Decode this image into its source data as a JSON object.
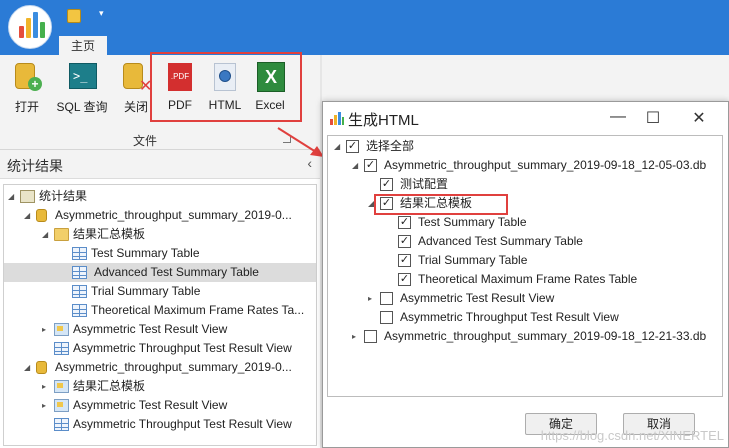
{
  "titlebar": {
    "tab_home": "主页",
    "qa_dropdown": "▾"
  },
  "ribbon": {
    "buttons": [
      {
        "id": "open",
        "label": "打开"
      },
      {
        "id": "sql",
        "label": "SQL 查询"
      },
      {
        "id": "close",
        "label": "关闭"
      },
      {
        "id": "pdf",
        "label": "PDF",
        "icon_text": ".PDF"
      },
      {
        "id": "html",
        "label": "HTML"
      },
      {
        "id": "excel",
        "label": "Excel",
        "icon_text": "X"
      }
    ],
    "group_label": "文件"
  },
  "left_panel": {
    "title": "统计结果",
    "collapse_glyph": "‹",
    "tree": [
      {
        "text": "统计结果",
        "icon": "root-icon",
        "level": 0,
        "toggle": "◢"
      },
      {
        "text": "Asymmetric_throughput_summary_2019-0...",
        "icon": "database-icon",
        "level": 1,
        "toggle": "◢"
      },
      {
        "text": "结果汇总模板",
        "icon": "folder-icon",
        "level": 2,
        "toggle": "◢"
      },
      {
        "text": "Test Summary Table",
        "icon": "table-icon",
        "level": 3,
        "toggle": ""
      },
      {
        "text": "Advanced Test Summary Table",
        "icon": "table-icon",
        "level": 3,
        "toggle": "",
        "selected": true
      },
      {
        "text": "Trial Summary Table",
        "icon": "table-icon",
        "level": 3,
        "toggle": ""
      },
      {
        "text": "Theoretical Maximum Frame Rates Ta...",
        "icon": "table-icon",
        "level": 3,
        "toggle": ""
      },
      {
        "text": "Asymmetric Test Result View",
        "icon": "view-icon",
        "level": 2,
        "toggle": "▸"
      },
      {
        "text": "Asymmetric Throughput Test Result View",
        "icon": "table-icon",
        "level": 2,
        "toggle": ""
      },
      {
        "text": "Asymmetric_throughput_summary_2019-0...",
        "icon": "database-icon",
        "level": 1,
        "toggle": "◢"
      },
      {
        "text": "结果汇总模板",
        "icon": "view-icon",
        "level": 2,
        "toggle": "▸"
      },
      {
        "text": "Asymmetric Test Result View",
        "icon": "view-icon",
        "level": 2,
        "toggle": "▸"
      },
      {
        "text": "Asymmetric Throughput Test Result View",
        "icon": "table-icon",
        "level": 2,
        "toggle": ""
      }
    ]
  },
  "dialog": {
    "title": "生成HTML",
    "minimize_glyph": "—",
    "maximize_glyph": "☐",
    "close_glyph": "✕",
    "tree": [
      {
        "text": "选择全部",
        "checked": true,
        "level": 0,
        "toggle": "◢"
      },
      {
        "text": "Asymmetric_throughput_summary_2019-09-18_12-05-03.db",
        "checked": true,
        "level": 1,
        "toggle": "◢"
      },
      {
        "text": "测试配置",
        "checked": true,
        "level": 2,
        "toggle": ""
      },
      {
        "text": "结果汇总模板",
        "checked": true,
        "level": 2,
        "toggle": "◢"
      },
      {
        "text": "Test Summary Table",
        "checked": true,
        "level": 3,
        "toggle": ""
      },
      {
        "text": "Advanced Test Summary Table",
        "checked": true,
        "level": 3,
        "toggle": ""
      },
      {
        "text": "Trial Summary Table",
        "checked": true,
        "level": 3,
        "toggle": ""
      },
      {
        "text": "Theoretical Maximum Frame Rates Table",
        "checked": true,
        "level": 3,
        "toggle": ""
      },
      {
        "text": "Asymmetric Test Result View",
        "checked": false,
        "level": 2,
        "toggle": "▸"
      },
      {
        "text": "Asymmetric Throughput Test Result View",
        "checked": false,
        "level": 2,
        "toggle": ""
      },
      {
        "text": "Asymmetric_throughput_summary_2019-09-18_12-21-33.db",
        "checked": false,
        "level": 1,
        "toggle": "▸"
      }
    ],
    "ok_label": "确定",
    "cancel_label": "取消",
    "watermark": "https://blog.csdn.net/XINERTEL"
  },
  "colors": {
    "titlebar": "#2b7bd6",
    "highlight": "#e0403e",
    "selection": "#dcdcdc"
  }
}
